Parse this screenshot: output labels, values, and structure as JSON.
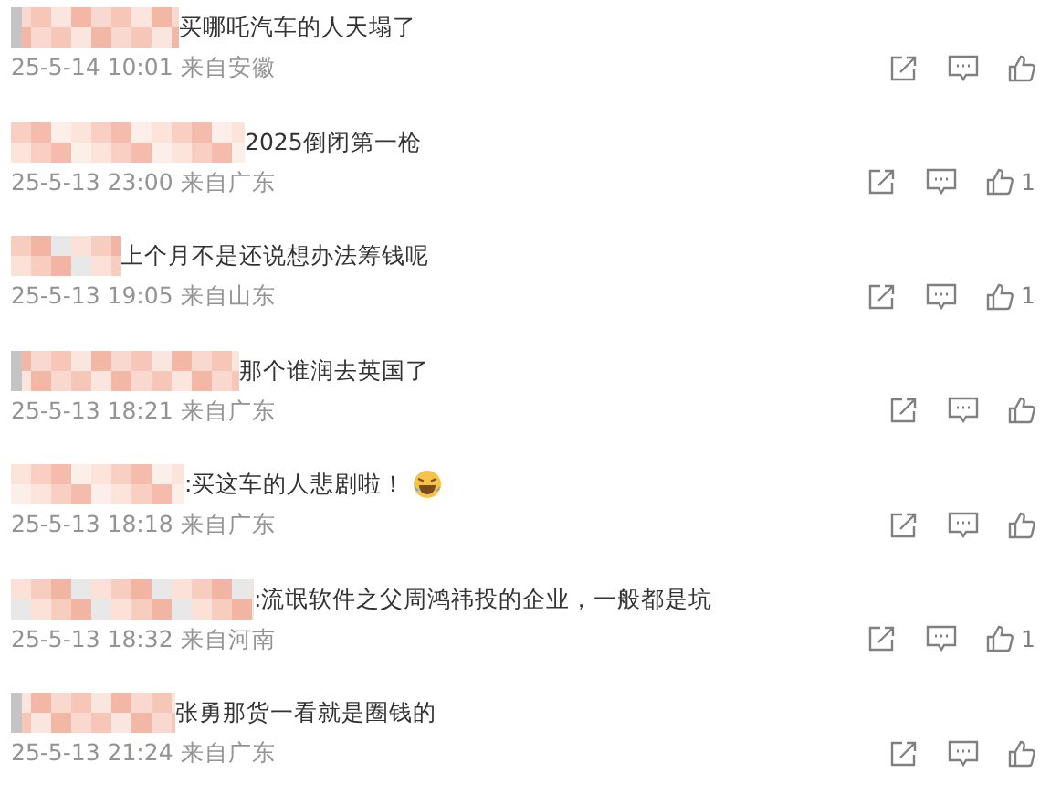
{
  "comments": [
    {
      "text": "买哪吒汽车的人天塌了",
      "time": "25-5-14 10:01",
      "location": "来自安徽",
      "has_emoji": false
    },
    {
      "text": "2025倒闭第一枪",
      "time": "25-5-13 23:00",
      "location": "来自广东",
      "has_emoji": false,
      "likes": "1"
    },
    {
      "text": "上个月不是还说想办法筹钱呢",
      "time": "25-5-13 19:05",
      "location": "来自山东",
      "has_emoji": false,
      "likes": "1"
    },
    {
      "text": "那个谁润去英国了",
      "time": "25-5-13 18:21",
      "location": "来自广东",
      "has_emoji": false
    },
    {
      "text": ":买这车的人悲剧啦！",
      "time": "25-5-13 18:18",
      "location": "来自广东",
      "has_emoji": true
    },
    {
      "text": ":流氓软件之父周鸿祎投的企业，一般都是坑",
      "time": "25-5-13 18:32",
      "location": "来自河南",
      "has_emoji": false,
      "likes": "1"
    },
    {
      "text": "张勇那货一看就是圈钱的",
      "time": "25-5-13 21:24",
      "location": "来自广东",
      "has_emoji": false
    }
  ]
}
